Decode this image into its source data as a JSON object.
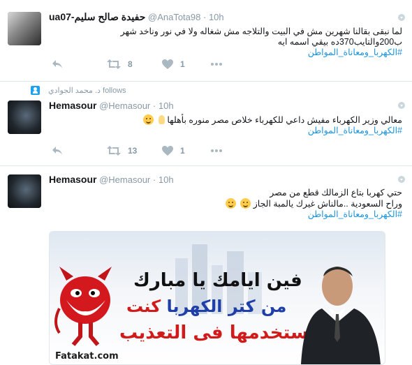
{
  "tweets": [
    {
      "name": "ua07-حفيدة صالح سليم",
      "handle": "@AnaTota98",
      "time": "10h",
      "text": "لما نبقى بقالنا شهرين مش في البيت والتلاجه مش شغاله ولا في نور وناخد شهر ب200والتايب370ده بيقي اسمه ايه",
      "hashtag": "#الكهربا_ومعاناة_المواطن",
      "retweets": "8",
      "likes": "1"
    },
    {
      "context": "د. محمد الجوادي follows",
      "name": "Hemasour",
      "handle": "@Hemasour",
      "time": "10h",
      "text": "معالي وزير الكهرباء مفيش داعي للكهرباء خلاص مصر منوره بأهلها",
      "hashtag": "#الكهربا_ومعاناة_المواطن",
      "retweets": "13",
      "likes": "1"
    },
    {
      "name": "Hemasour",
      "handle": "@Hemasour",
      "time": "10h",
      "line1": "حتي كهربا بتاع الزمالك قطع من مصر",
      "line2": "وراح السعودية ..مالناش غيرك يالمبة الجاز",
      "hashtag": "#الكهربا_ومعاناة_المواطن",
      "image": {
        "line1": "فين ايامك يا مبارك",
        "line2_blue": "من كتر الكهربا",
        "line2_red": "كنت",
        "line3": "بتستخدمها فى التعذيب",
        "watermark": "Fatakat.com"
      }
    }
  ],
  "dot": "·",
  "icons": [
    "reply-icon",
    "retweet-icon",
    "like-icon",
    "more-icon",
    "caret-icon",
    "follow-user-icon"
  ],
  "colors": {
    "hashtag": "#1b95e0",
    "muted": "#8899a6",
    "icon": "#aab8c2"
  }
}
